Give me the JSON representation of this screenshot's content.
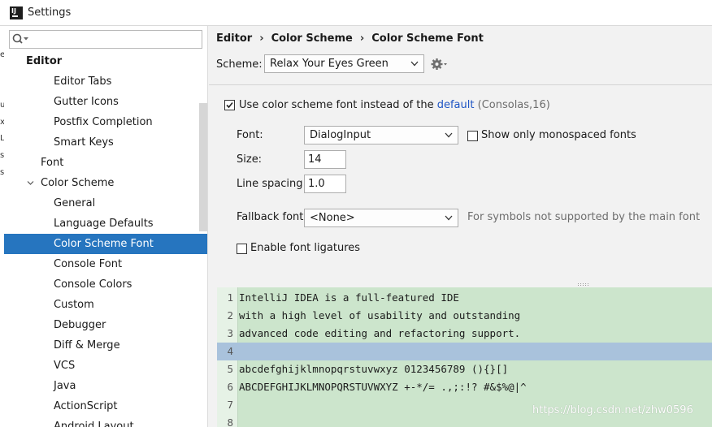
{
  "window": {
    "title": "Settings"
  },
  "edge_text": [
    "e",
    "u",
    "x",
    "L",
    "s",
    "s"
  ],
  "search": {
    "value": "",
    "placeholder": ""
  },
  "sidebar": {
    "items": [
      {
        "label": "Editor",
        "level": 0,
        "bold": true
      },
      {
        "label": "Editor Tabs",
        "level": 2
      },
      {
        "label": "Gutter Icons",
        "level": 2
      },
      {
        "label": "Postfix Completion",
        "level": 2
      },
      {
        "label": "Smart Keys",
        "level": 2
      },
      {
        "label": "Font",
        "level": 1
      },
      {
        "label": "Color Scheme",
        "level": 1,
        "expanded": true
      },
      {
        "label": "General",
        "level": 2
      },
      {
        "label": "Language Defaults",
        "level": 2
      },
      {
        "label": "Color Scheme Font",
        "level": 2,
        "selected": true
      },
      {
        "label": "Console Font",
        "level": 2
      },
      {
        "label": "Console Colors",
        "level": 2
      },
      {
        "label": "Custom",
        "level": 2
      },
      {
        "label": "Debugger",
        "level": 2
      },
      {
        "label": "Diff & Merge",
        "level": 2
      },
      {
        "label": "VCS",
        "level": 2
      },
      {
        "label": "Java",
        "level": 2
      },
      {
        "label": "ActionScript",
        "level": 2
      },
      {
        "label": "Android Layout",
        "level": 2
      }
    ]
  },
  "breadcrumb": [
    "Editor",
    "Color Scheme",
    "Color Scheme Font"
  ],
  "scheme": {
    "label": "Scheme:",
    "value": "Relax Your Eyes Green"
  },
  "use_scheme_font": {
    "checked": true,
    "text_before": "Use color scheme font instead of the",
    "link": "default",
    "text_after": "(Consolas,16)"
  },
  "font": {
    "label": "Font:",
    "value": "DialogInput"
  },
  "monospaced": {
    "checked": false,
    "label": "Show only monospaced fonts"
  },
  "size": {
    "label": "Size:",
    "value": "14"
  },
  "line_spacing": {
    "label": "Line spacing:",
    "value": "1.0"
  },
  "fallback": {
    "label": "Fallback font:",
    "value": "<None>",
    "hint": "For symbols not supported by the main font"
  },
  "ligatures": {
    "checked": false,
    "label": "Enable font ligatures"
  },
  "preview": {
    "current_line": 4,
    "lines": [
      {
        "num": "1",
        "text": "IntelliJ IDEA is a full-featured IDE"
      },
      {
        "num": "2",
        "text": "with a high level of usability and outstanding"
      },
      {
        "num": "3",
        "text": "advanced code editing and refactoring support."
      },
      {
        "num": "4",
        "text": ""
      },
      {
        "num": "5",
        "text": "abcdefghijklmnopqrstuvwxyz 0123456789 (){}[]"
      },
      {
        "num": "6",
        "text": "ABCDEFGHIJKLMNOPQRSTUVWXYZ +-*/= .,;:!? #&$%@|^"
      },
      {
        "num": "7",
        "text": ""
      },
      {
        "num": "8",
        "text": ""
      }
    ]
  },
  "watermark": "https://blog.csdn.net/zhw0596",
  "colors": {
    "selection": "#2675bf",
    "preview_background": "#cce5cc",
    "caret_row": "#a9c2dc",
    "link": "#1f55c4"
  }
}
